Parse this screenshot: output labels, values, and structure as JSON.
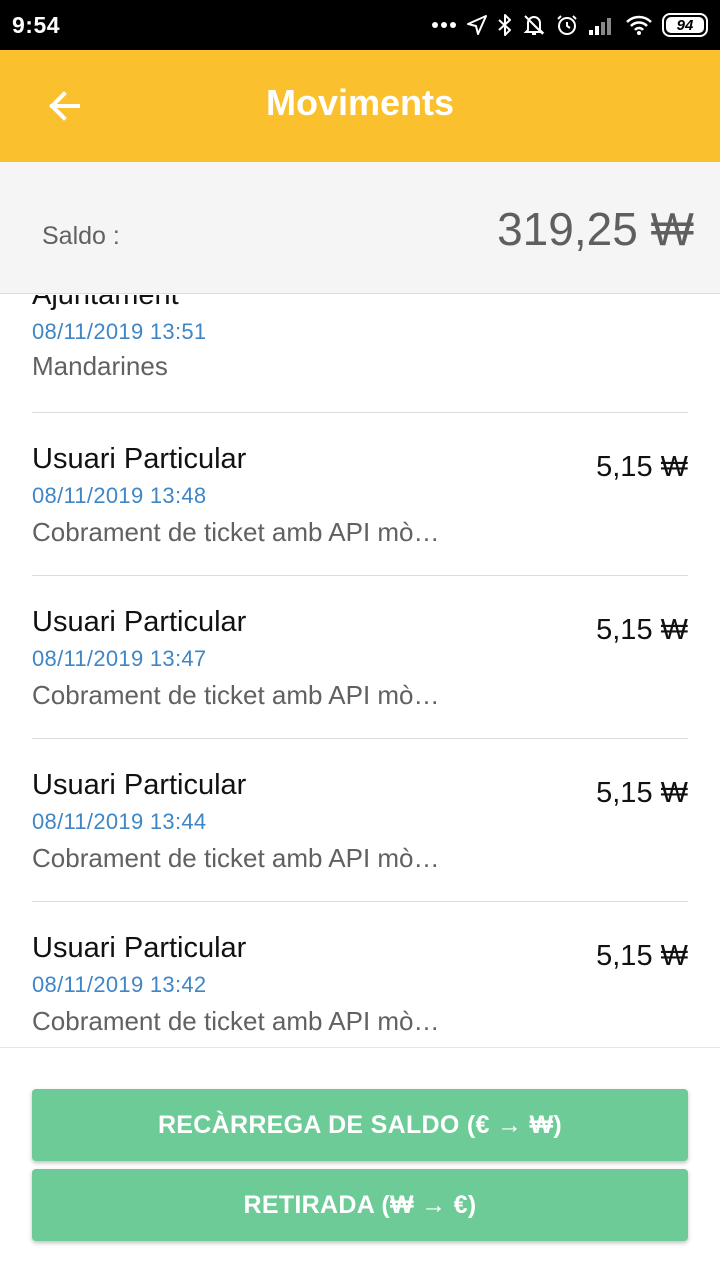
{
  "status_bar": {
    "time": "9:54",
    "battery": "94",
    "icons": [
      "more-dots-icon",
      "location-arrow-icon",
      "bluetooth-icon",
      "bell-off-icon",
      "alarm-icon",
      "signal-icon",
      "wifi-icon",
      "battery-icon"
    ]
  },
  "app_bar": {
    "title": "Moviments",
    "back_icon": "arrow-left-icon",
    "color": "#fbc02d"
  },
  "balance": {
    "label": "Saldo :",
    "value": "319,25 ₩"
  },
  "transactions": [
    {
      "name": "Ajuntament",
      "date": "08/11/2019 13:51",
      "description": "Mandarines",
      "amount": ""
    },
    {
      "name": "Usuari Particular",
      "date": "08/11/2019 13:48",
      "description": "Cobrament de ticket amb API mò…",
      "amount": "5,15 ₩"
    },
    {
      "name": "Usuari Particular",
      "date": "08/11/2019 13:47",
      "description": "Cobrament de ticket amb API mò…",
      "amount": "5,15 ₩"
    },
    {
      "name": "Usuari Particular",
      "date": "08/11/2019 13:44",
      "description": "Cobrament de ticket amb API mò…",
      "amount": "5,15 ₩"
    },
    {
      "name": "Usuari Particular",
      "date": "08/11/2019 13:42",
      "description": "Cobrament de ticket amb API mò…",
      "amount": "5,15 ₩"
    }
  ],
  "actions": {
    "recharge_label": "RECÀRREGA DE SALDO (€ → ₩)",
    "withdraw_label": "RETIRADA (₩ → €)",
    "button_color": "#6ccb97"
  }
}
